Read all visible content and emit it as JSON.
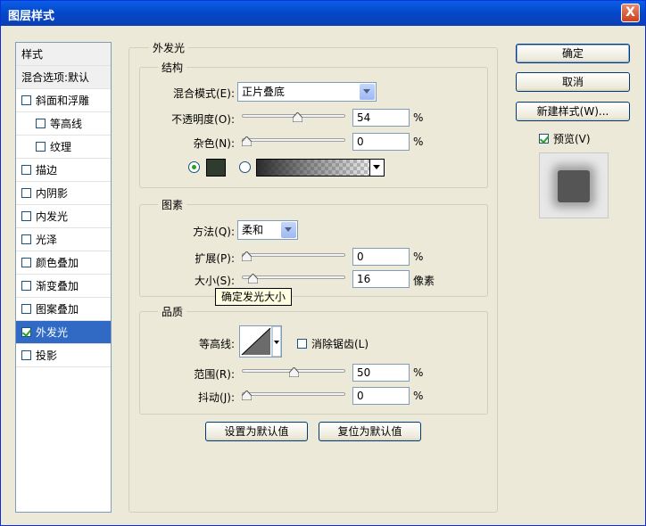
{
  "window": {
    "title": "图层样式",
    "close_glyph": "X"
  },
  "style_list": {
    "header": "样式",
    "blend_options": "混合选项:默认",
    "items": [
      {
        "label": "斜面和浮雕",
        "checked": false,
        "indent": false
      },
      {
        "label": "等高线",
        "checked": false,
        "indent": true
      },
      {
        "label": "纹理",
        "checked": false,
        "indent": true
      },
      {
        "label": "描边",
        "checked": false,
        "indent": false
      },
      {
        "label": "内阴影",
        "checked": false,
        "indent": false
      },
      {
        "label": "内发光",
        "checked": false,
        "indent": false
      },
      {
        "label": "光泽",
        "checked": false,
        "indent": false
      },
      {
        "label": "颜色叠加",
        "checked": false,
        "indent": false
      },
      {
        "label": "渐变叠加",
        "checked": false,
        "indent": false
      },
      {
        "label": "图案叠加",
        "checked": false,
        "indent": false
      },
      {
        "label": "外发光",
        "checked": true,
        "indent": false,
        "selected": true
      },
      {
        "label": "投影",
        "checked": false,
        "indent": false
      }
    ]
  },
  "outer_glow": {
    "title": "外发光",
    "structure": {
      "legend": "结构",
      "blend_mode_label": "混合模式(E):",
      "blend_mode_value": "正片叠底",
      "opacity_label": "不透明度(O):",
      "opacity_value": "54",
      "opacity_fraction": 0.54,
      "opacity_unit": "%",
      "noise_label": "杂色(N):",
      "noise_value": "0",
      "noise_fraction": 0,
      "noise_unit": "%",
      "color_swatch": "#2e3b2e"
    },
    "elements": {
      "legend": "图素",
      "technique_label": "方法(Q):",
      "technique_value": "柔和",
      "spread_label": "扩展(P):",
      "spread_value": "0",
      "spread_fraction": 0,
      "spread_unit": "%",
      "size_label": "大小(S):",
      "size_value": "16",
      "size_fraction": 0.065,
      "size_unit": "像素",
      "tooltip": "确定发光大小"
    },
    "quality": {
      "legend": "品质",
      "contour_label": "等高线:",
      "antialias_label": "消除锯齿(L)",
      "antialias_checked": false,
      "range_label": "范围(R):",
      "range_value": "50",
      "range_fraction": 0.5,
      "range_unit": "%",
      "jitter_label": "抖动(J):",
      "jitter_value": "0",
      "jitter_fraction": 0,
      "jitter_unit": "%"
    },
    "make_default_label": "设置为默认值",
    "reset_default_label": "复位为默认值"
  },
  "buttons": {
    "ok": "确定",
    "cancel": "取消",
    "new_style": "新建样式(W)...",
    "preview_label": "预览(V)",
    "preview_checked": true
  }
}
